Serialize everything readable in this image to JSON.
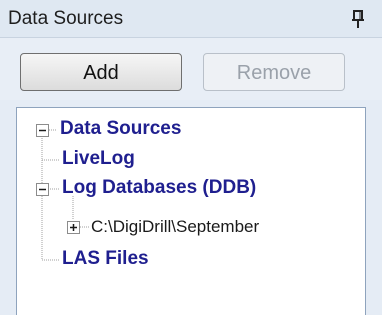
{
  "panel": {
    "title": "Data Sources",
    "pin_icon": "pin-icon"
  },
  "toolbar": {
    "add_label": "Add",
    "remove_label": "Remove"
  },
  "tree": {
    "root": {
      "label": "Data Sources",
      "expanded": true,
      "children": [
        {
          "label": "LiveLog"
        },
        {
          "label": "Log Databases (DDB)",
          "expanded": true,
          "children": [
            {
              "label": "C:\\DigiDrill\\September",
              "expanded": false
            }
          ]
        },
        {
          "label": "LAS Files"
        }
      ]
    }
  },
  "colors": {
    "node_text": "#1f1f8f",
    "panel_background": "#e5ecf5",
    "tree_border": "#8ea3bd"
  }
}
